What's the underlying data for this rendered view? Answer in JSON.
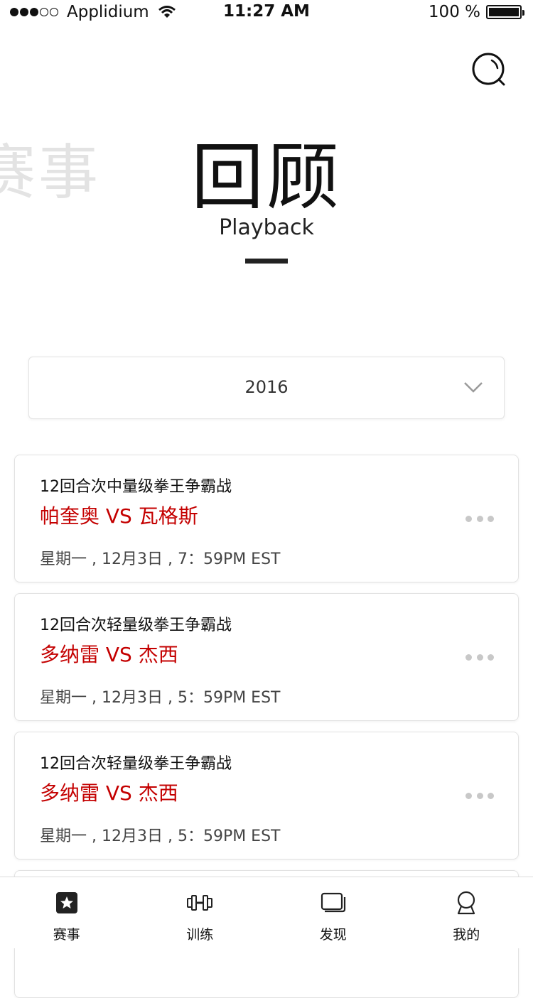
{
  "status_bar": {
    "carrier": "Applidium",
    "time": "11:27 AM",
    "battery": "100 %"
  },
  "header": {
    "ghost_title": "赛事",
    "title": "回顾",
    "subtitle": "Playback"
  },
  "year_selector": {
    "value": "2016"
  },
  "events": [
    {
      "class": "12回合次中量级拳王争霸战",
      "match": "帕奎奥 VS 瓦格斯",
      "time": "星期一 , 12月3日 , 7：59PM EST"
    },
    {
      "class": "12回合次轻量级拳王争霸战",
      "match": "多纳雷 VS 杰西",
      "time": "星期一 , 12月3日 , 5：59PM EST"
    },
    {
      "class": "12回合次轻量级拳王争霸战",
      "match": "多纳雷 VS 杰西",
      "time": "星期一 , 12月3日 , 5：59PM EST"
    }
  ],
  "tab_bar": {
    "items": [
      {
        "label": "赛事",
        "icon": "star-badge-icon"
      },
      {
        "label": "训练",
        "icon": "dumbbell-icon"
      },
      {
        "label": "发现",
        "icon": "cards-icon"
      },
      {
        "label": "我的",
        "icon": "user-icon"
      }
    ]
  },
  "colors": {
    "accent_red": "#c40000",
    "text": "#111111",
    "ghost": "#e3e3e3"
  }
}
